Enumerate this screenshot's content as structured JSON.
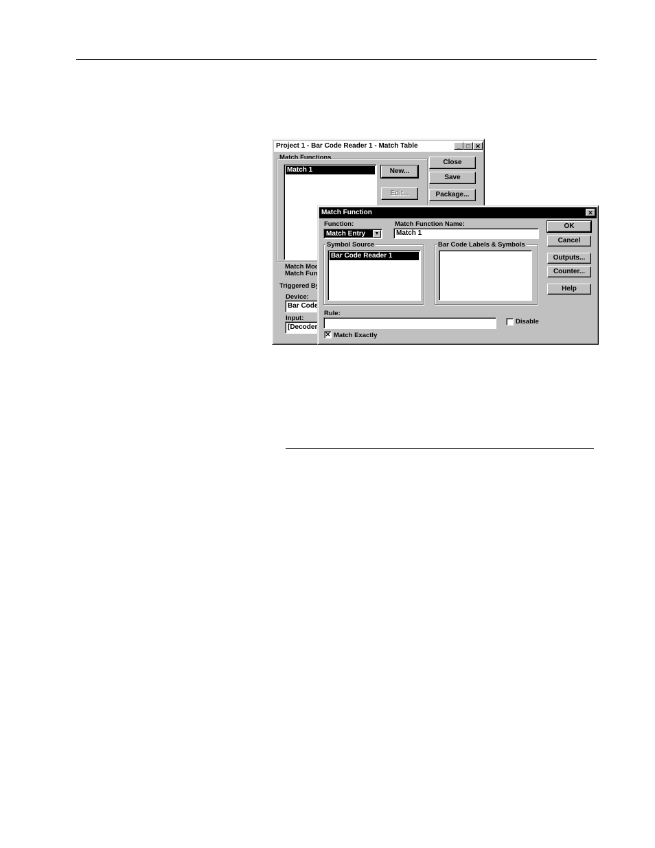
{
  "match_table": {
    "title": "Project 1 - Bar Code Reader 1 - Match Table",
    "match_functions_label": "Match Functions",
    "list_items": [
      "Match 1"
    ],
    "new_label": "New...",
    "edit_label": "Edit...",
    "close_label": "Close",
    "save_label": "Save",
    "package_label": "Package...",
    "match_mode_label": "Match Mod",
    "match_func_label": "Match Fun",
    "triggered_by_label": "Triggered By",
    "device_label": "Device:",
    "device_value": "Bar Code",
    "input_label": "Input:",
    "input_value": "[Decoder"
  },
  "match_function": {
    "title": "Match Function",
    "function_label": "Function:",
    "function_value": "Match Entry",
    "name_label": "Match Function Name:",
    "name_value": "Match 1",
    "symbol_source_label": "Symbol Source",
    "symbol_source_items": [
      "Bar Code Reader 1"
    ],
    "labels_symbols_label": "Bar Code Labels & Symbols",
    "rule_label": "Rule:",
    "rule_value": "",
    "disable_label": "Disable",
    "match_exactly_label": "Match Exactly",
    "match_exactly_checked": true,
    "ok_label": "OK",
    "cancel_label": "Cancel",
    "outputs_label": "Outputs...",
    "counter_label": "Counter...",
    "help_label": "Help"
  }
}
